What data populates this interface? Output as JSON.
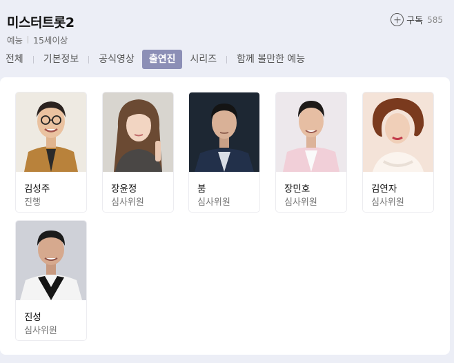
{
  "program": {
    "title": "미스터트롯2",
    "genre": "예능",
    "rating": "15세이상"
  },
  "subscribe": {
    "label": "구독",
    "count": "585",
    "icon": "plus-circle-icon"
  },
  "tabs": [
    {
      "label": "전체",
      "active": false
    },
    {
      "label": "기본정보",
      "active": false
    },
    {
      "label": "공식영상",
      "active": false
    },
    {
      "label": "출연진",
      "active": true
    },
    {
      "label": "시리즈",
      "active": false
    },
    {
      "label": "함께 볼만한 예능",
      "active": false
    }
  ],
  "cast": [
    {
      "name": "김성주",
      "role": "진행"
    },
    {
      "name": "장윤정",
      "role": "심사위원"
    },
    {
      "name": "붐",
      "role": "심사위원"
    },
    {
      "name": "장민호",
      "role": "심사위원"
    },
    {
      "name": "김연자",
      "role": "심사위원"
    },
    {
      "name": "진성",
      "role": "심사위원"
    }
  ]
}
